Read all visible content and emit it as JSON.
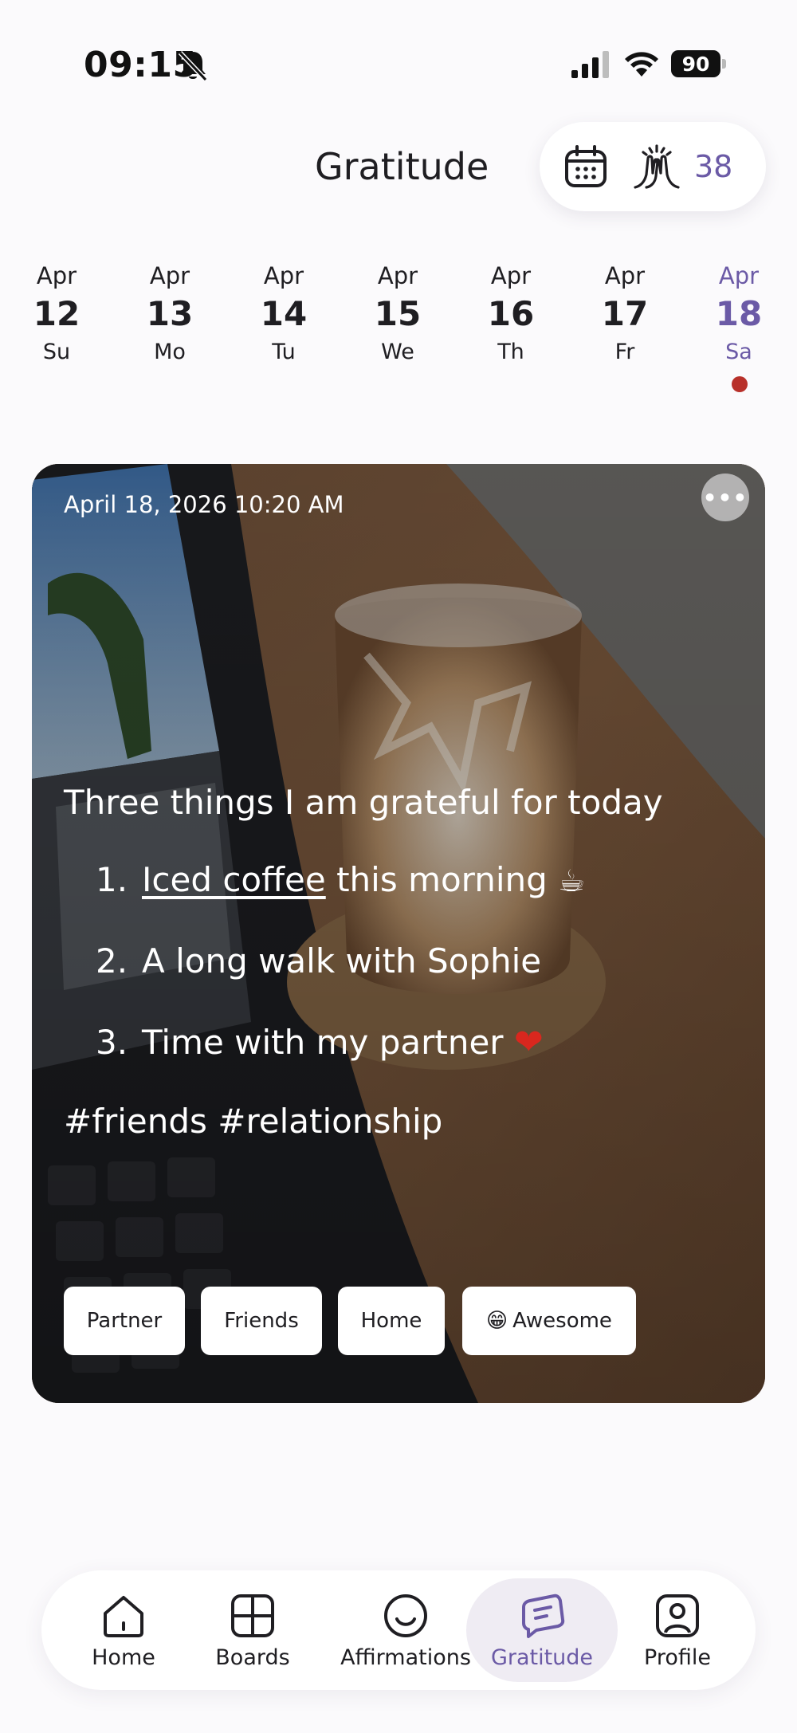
{
  "status_bar": {
    "time": "09:15",
    "battery": "90"
  },
  "header": {
    "title": "Gratitude",
    "streak_count": "38"
  },
  "date_strip": [
    {
      "month": "Apr",
      "day": "12",
      "weekday": "Su"
    },
    {
      "month": "Apr",
      "day": "13",
      "weekday": "Mo"
    },
    {
      "month": "Apr",
      "day": "14",
      "weekday": "Tu"
    },
    {
      "month": "Apr",
      "day": "15",
      "weekday": "We"
    },
    {
      "month": "Apr",
      "day": "16",
      "weekday": "Th"
    },
    {
      "month": "Apr",
      "day": "17",
      "weekday": "Fr"
    },
    {
      "month": "Apr",
      "day": "18",
      "weekday": "Sa",
      "selected": true
    }
  ],
  "entry": {
    "timestamp": "April 18, 2026 10:20 AM",
    "heading": "Three things I am grateful for today",
    "items": [
      {
        "num": "1.",
        "link": "Iced coffee",
        "text": " this morning ",
        "emoji": "☕"
      },
      {
        "num": "2.",
        "text": "A long walk with Sophie"
      },
      {
        "num": "3.",
        "text": "Time with my partner ",
        "emoji": "❤"
      }
    ],
    "hashtags": "#friends #relationship",
    "tags": [
      "Partner",
      "Friends",
      "Home",
      "Awesome"
    ],
    "mood_emoji": "😁"
  },
  "nav": [
    {
      "label": "Home"
    },
    {
      "label": "Boards"
    },
    {
      "label": "Affirmations"
    },
    {
      "label": "Gratitude",
      "active": true
    },
    {
      "label": "Profile"
    }
  ],
  "colors": {
    "accent": "#6b5aa6",
    "background": "#fbfafc",
    "today_dot": "#b8302a",
    "active_nav_bg": "#efecf3"
  },
  "icons": {
    "status": [
      "bell-off-icon",
      "signal-icon",
      "wifi-icon",
      "battery-icon"
    ],
    "header": [
      "calendar-icon",
      "high-five-icon"
    ],
    "entry": [
      "more-icon"
    ],
    "nav": [
      "home-icon",
      "boards-icon",
      "affirmations-icon",
      "gratitude-icon",
      "profile-icon"
    ]
  }
}
